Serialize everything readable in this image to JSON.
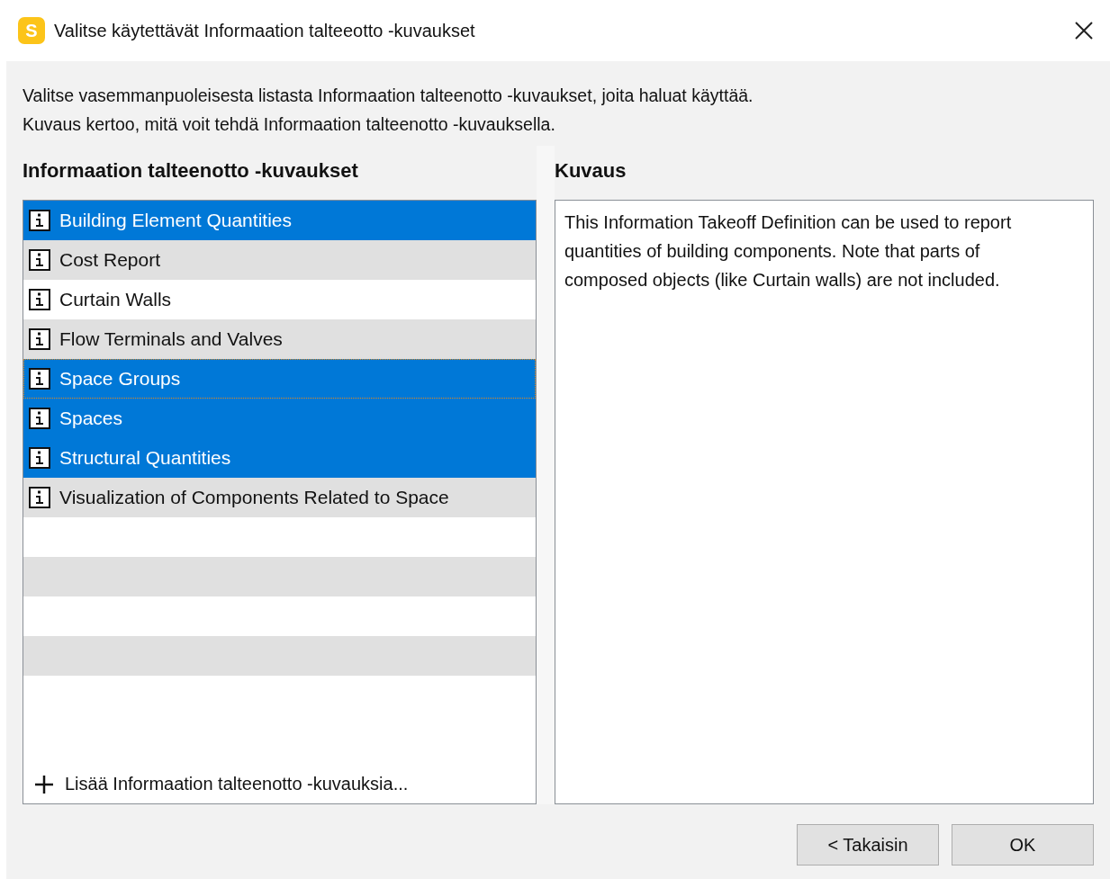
{
  "window": {
    "title": "Valitse käytettävät Informaation talteeotto -kuvaukset",
    "app_icon_letter": "S"
  },
  "intro": [
    "Valitse vasemmanpuoleisesta listasta Informaation talteenotto -kuvaukset, joita haluat käyttää.",
    "Kuvaus kertoo, mitä voit tehdä Informaation talteenotto -kuvauksella."
  ],
  "definitions": {
    "heading": "Informaation talteenotto -kuvaukset",
    "items": [
      {
        "label": "Building Element Quantities",
        "selected": true,
        "focused": false
      },
      {
        "label": "Cost Report",
        "selected": false,
        "focused": false
      },
      {
        "label": "Curtain Walls",
        "selected": false,
        "focused": false
      },
      {
        "label": "Flow Terminals and Valves",
        "selected": false,
        "focused": false
      },
      {
        "label": "Space Groups",
        "selected": true,
        "focused": true
      },
      {
        "label": "Spaces",
        "selected": true,
        "focused": false
      },
      {
        "label": "Structural Quantities",
        "selected": true,
        "focused": false
      },
      {
        "label": "Visualization of Components Related to Space",
        "selected": false,
        "focused": false
      }
    ],
    "add_link": "Lisää Informaation talteenotto -kuvauksia..."
  },
  "description": {
    "heading": "Kuvaus",
    "text": "This Information Takeoff Definition can be used to report quantities of building components. Note that parts of composed objects (like Curtain walls) are not included."
  },
  "buttons": [
    "< Takaisin",
    "OK"
  ]
}
